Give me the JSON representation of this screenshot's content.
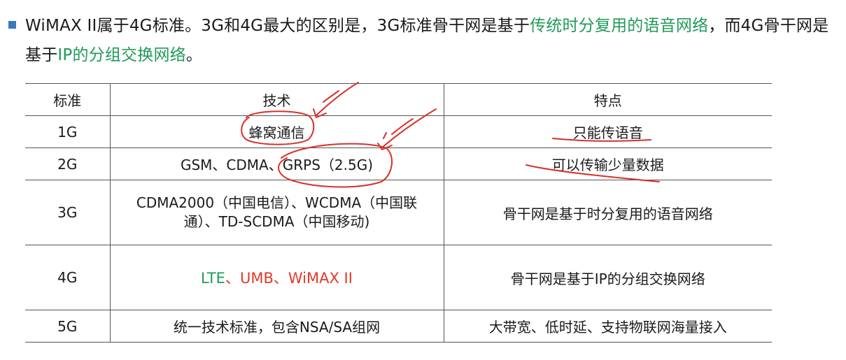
{
  "intro": {
    "part1": "WiMAX II属于4G标准。3G和4G最大的区别是，3G标准骨干网是基于",
    "highlight1": "传统时分复用的语音网络",
    "part2": "，而4G骨干网是基于",
    "highlight2": "IP的分组交换网络",
    "part3": "。"
  },
  "table": {
    "headers": [
      "标准",
      "技术",
      "特点"
    ],
    "rows": [
      {
        "standard": "1G",
        "tech": "蜂窝通信",
        "feature": "只能传语音"
      },
      {
        "standard": "2G",
        "tech": "GSM、CDMA、GRPS（2.5G)",
        "feature": "可以传输少量数据"
      },
      {
        "standard": "3G",
        "tech_line1": "CDMA2000（中国电信）、WCDMA（中国联",
        "tech_line2": "通）、TD-SCDMA（中国移动)",
        "feature": "骨干网是基于时分复用的语音网络"
      },
      {
        "standard": "4G",
        "tech_parts": [
          "LTE",
          "、",
          "UMB",
          "、",
          "WiMAX II"
        ],
        "feature": "骨干网是基于IP的分组交换网络"
      },
      {
        "standard": "5G",
        "tech": "统一技术标准，包含NSA/SA组网",
        "feature": "大带宽、低时延、支持物联网海量接入"
      }
    ]
  },
  "colors": {
    "highlight_green": "#1f9a58",
    "highlight_red": "#e03a2a",
    "bullet_blue": "#3a78c2",
    "annotation_red": "#d8302a"
  }
}
